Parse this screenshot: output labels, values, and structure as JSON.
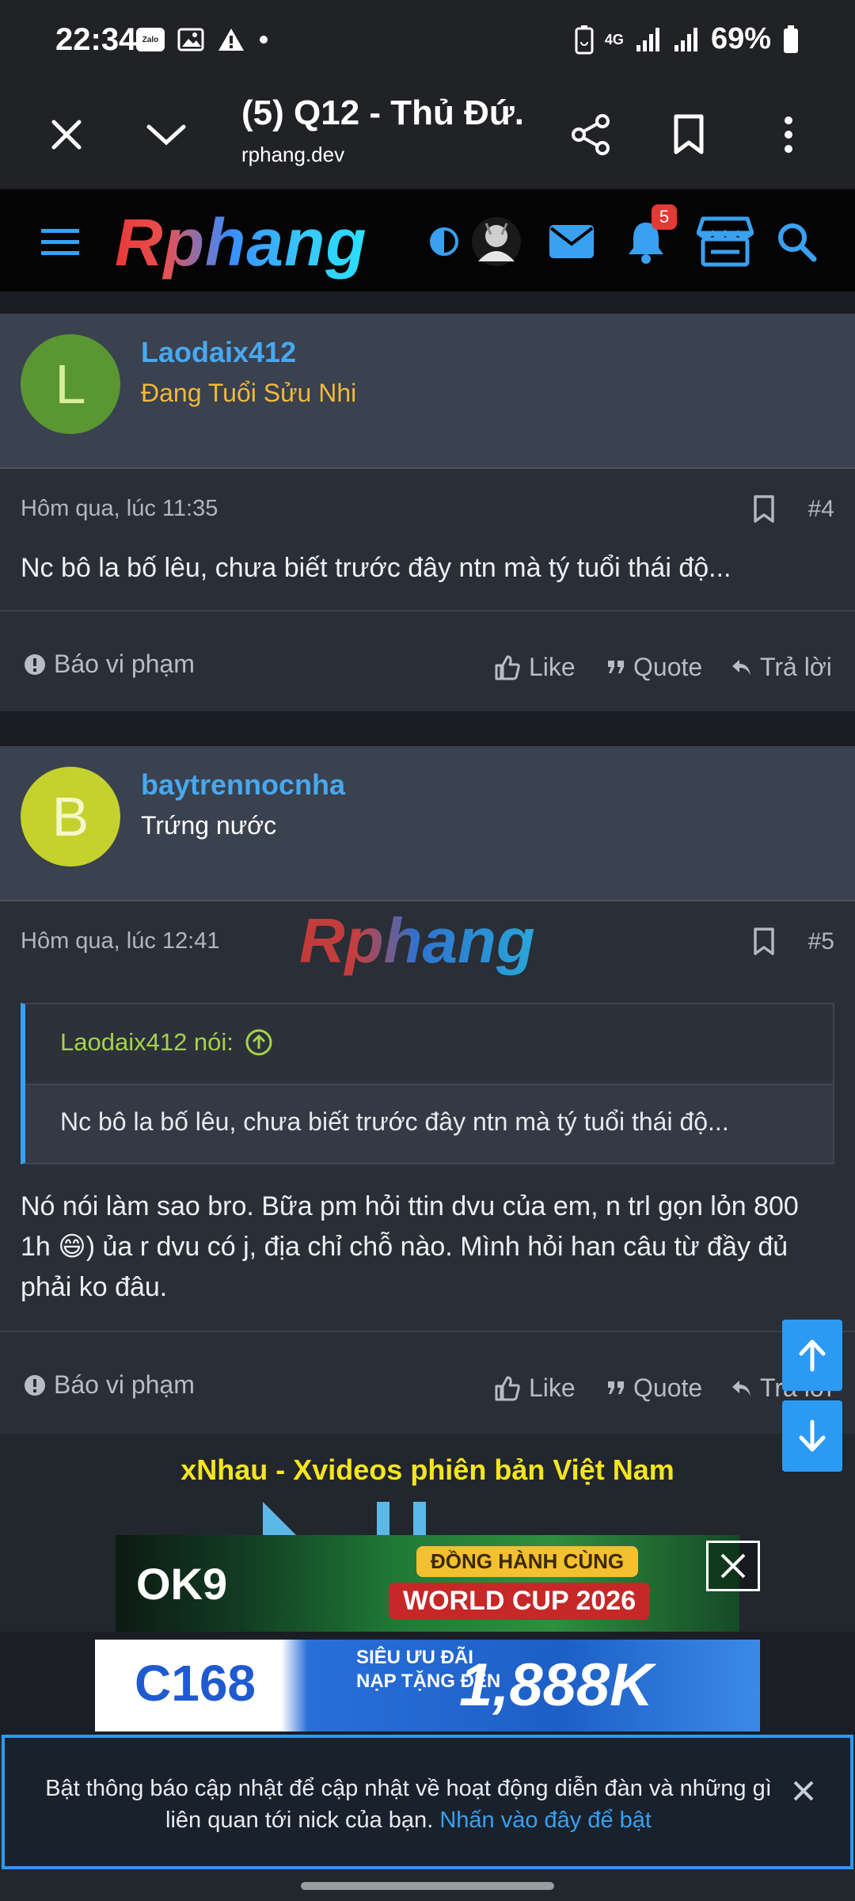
{
  "status": {
    "time": "22:34",
    "zalo_label": "Zalo",
    "battery": "69%",
    "network": "4G"
  },
  "browser": {
    "title": "(5) Q12 - Thủ Đứ...",
    "url": "rphang.dev"
  },
  "site": {
    "logo_text": "Rphang",
    "notification_count": "5"
  },
  "posts": [
    {
      "avatar_letter": "L",
      "avatar_color": "#5a9631",
      "avatar_text_color": "#d6ef9a",
      "username": "Laodaix412",
      "user_title": "Đang Tuổi Sửu Nhi",
      "user_title_color": "#f0b93a",
      "timestamp": "Hôm qua, lúc 11:35",
      "number": "#4",
      "body": "Nc bô la bố lêu, chưa biết trước đây ntn mà tý tuổi thái độ..."
    },
    {
      "avatar_letter": "B",
      "avatar_color": "#c5d12d",
      "avatar_text_color": "#f4f7c7",
      "username": "baytrennocnha",
      "user_title": "Trứng nước",
      "user_title_color": "#ffffff",
      "timestamp": "Hôm qua, lúc 12:41",
      "number": "#5",
      "watermark": "Rphang",
      "quote_author": "Laodaix412 nói:",
      "quote_text": "Nc bô la bố lêu, chưa biết trước đây ntn mà tý tuổi thái độ...",
      "body": "Nó nói làm sao bro. Bữa pm hỏi ttin dvu của em, n trl gọn lỏn 800 1h 😄) ủa r dvu có j, địa chỉ chỗ nào. Mình hỏi han câu từ đầy đủ phải ko đâu."
    }
  ],
  "actions": {
    "report": "Báo vi phạm",
    "like": "Like",
    "quote": "Quote",
    "reply": "Trả lời"
  },
  "ads": {
    "headline": "xNhau - Xvideos phiên bản Việt Nam",
    "ad1_brand": "OK9",
    "ad1_tag1": "ĐỒNG HÀNH CÙNG",
    "ad1_tag2": "WORLD CUP 2026",
    "ad2_brand": "C168",
    "ad2_promo_line1": "SIÊU ƯU ĐÃI",
    "ad2_promo_line2": "NẠP TẶNG ĐẾN",
    "ad2_amount": "1,888K"
  },
  "notice": {
    "text": "Bật thông báo cập nhật để cập nhật về hoạt động diễn đàn và những gì liên quan tới nick của bạn.",
    "link": "Nhấn vào đây để bật"
  }
}
